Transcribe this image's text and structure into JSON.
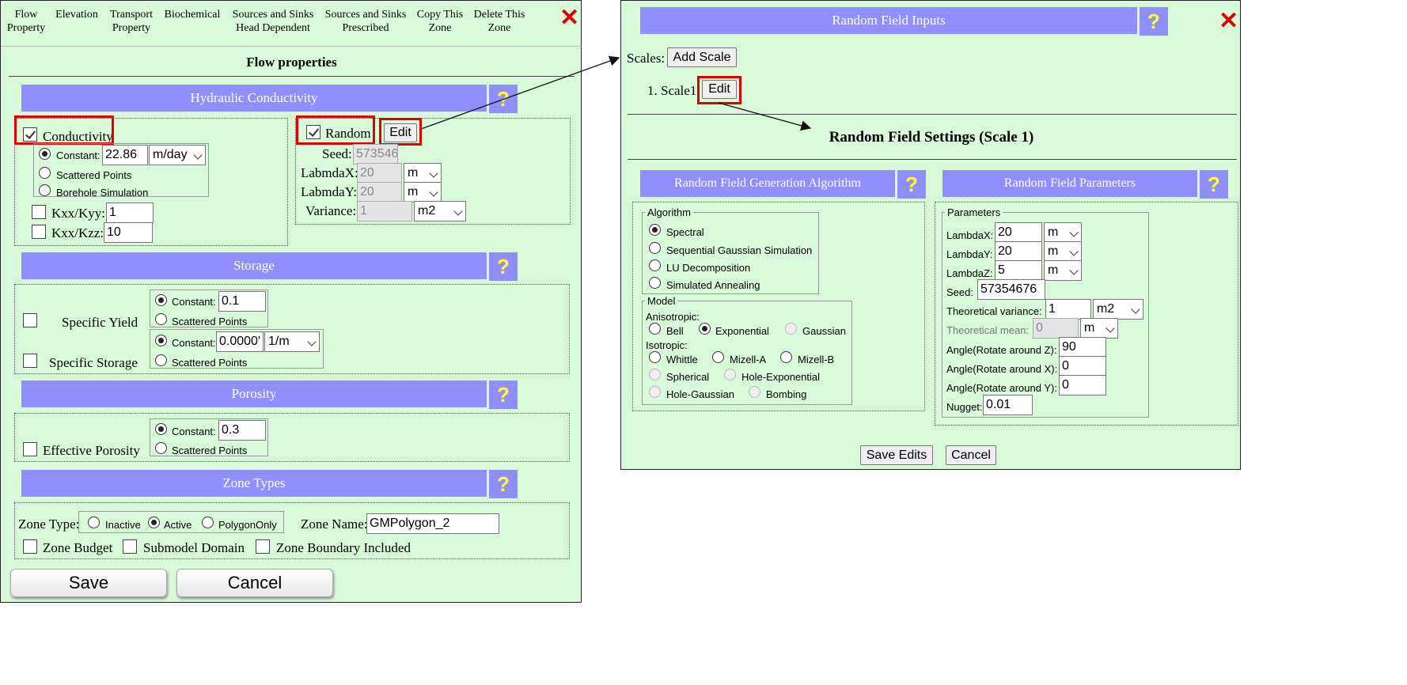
{
  "left": {
    "menu": [
      "Flow Property",
      "Elevation",
      "Transport Property",
      "Biochemical",
      "Sources and Sinks Head Dependent",
      "Sources and Sinks Prescribed",
      "Copy This Zone",
      "Delete This Zone"
    ],
    "title": "Flow properties",
    "hydraulic": {
      "header": "Hydraulic Conductivity",
      "conductivity_label": "Conductivity",
      "constant_label": "Constant:",
      "constant_value": "22.86",
      "unit": "m/day",
      "scattered": "Scattered Points",
      "borehole": "Borehole Simulation",
      "kxx_kyy_label": "Kxx/Kyy:",
      "kxx_kyy": "1",
      "kxx_kzz_label": "Kxx/Kzz:",
      "kxx_kzz": "10",
      "random_label": "Random",
      "edit": "Edit",
      "seed_label": "Seed:",
      "seed": "573546",
      "lambda_x_label": "LabmdaX:",
      "lambda_x": "20",
      "lambda_x_unit": "m",
      "lambda_y_label": "LabmdaY:",
      "lambda_y": "20",
      "lambda_y_unit": "m",
      "variance_label": "Variance:",
      "variance": "1",
      "variance_unit": "m2"
    },
    "storage": {
      "header": "Storage",
      "specific_yield": "Specific Yield",
      "sy_constant_label": "Constant:",
      "sy_value": "0.1",
      "sy_scattered": "Scattered Points",
      "specific_storage": "Specific Storage",
      "ss_constant_label": "Constant:",
      "ss_value": "0.0000'",
      "ss_unit": "1/m",
      "ss_scattered": "Scattered Points"
    },
    "porosity": {
      "header": "Porosity",
      "effective": "Effective Porosity",
      "constant_label": "Constant:",
      "value": "0.3",
      "scattered": "Scattered Points"
    },
    "zone": {
      "header": "Zone Types",
      "type_label": "Zone Type:",
      "inactive": "Inactive",
      "active": "Active",
      "polygon_only": "PolygonOnly",
      "name_label": "Zone Name:",
      "name_value": "GMPolygon_2",
      "budget": "Zone Budget",
      "submodel": "Submodel Domain",
      "boundary": "Zone Boundary Included"
    },
    "save": "Save",
    "cancel": "Cancel",
    "help": "?"
  },
  "right": {
    "header": "Random Field Inputs",
    "scales_label": "Scales:",
    "add_scale": "Add Scale",
    "scale_item": "1.  Scale1",
    "edit": "Edit",
    "settings_title": "Random Field Settings (Scale 1)",
    "algo_header": "Random Field Generation Algorithm",
    "algo_legend": "Algorithm",
    "algorithms": [
      "Spectral",
      "Sequential Gaussian Simulation",
      "LU Decomposition",
      "Simulated Annealing"
    ],
    "model_legend": "Model",
    "anisotropic": "Anisotropic:",
    "bell": "Bell",
    "exponential": "Exponential",
    "gaussian": "Gaussian",
    "isotropic": "Isotropic:",
    "whittle": "Whittle",
    "mizell_a": "Mizell-A",
    "mizell_b": "Mizell-B",
    "spherical": "Spherical",
    "hole_exponential": "Hole-Exponential",
    "hole_gaussian": "Hole-Gaussian",
    "bombing": "Bombing",
    "params_header": "Random Field Parameters",
    "params_legend": "Parameters",
    "lambda_x_label": "LambdaX:",
    "lambda_x": "20",
    "lambda_x_unit": "m",
    "lambda_y_label": "LambdaY:",
    "lambda_y": "20",
    "lambda_y_unit": "m",
    "lambda_z_label": "LambdaZ:",
    "lambda_z": "5",
    "lambda_z_unit": "m",
    "seed_label": "Seed:",
    "seed": "57354676",
    "var_label": "Theoretical variance:",
    "var": "1",
    "var_unit": "m2",
    "mean_label": "Theoretical mean:",
    "mean": "0",
    "mean_unit": "m",
    "angle_z_label": "Angle(Rotate around Z):",
    "angle_z": "90",
    "angle_x_label": "Angle(Rotate around X):",
    "angle_x": "0",
    "angle_y_label": "Angle(Rotate around Y):",
    "angle_y": "0",
    "nugget_label": "Nugget:",
    "nugget": "0.01",
    "save_edits": "Save Edits",
    "cancel": "Cancel",
    "help": "?"
  },
  "colors": {
    "panel_bg": "#d9fad9",
    "header_bar": "#8f8fff",
    "help_mark": "#ffff33",
    "highlight": "#e00000"
  }
}
